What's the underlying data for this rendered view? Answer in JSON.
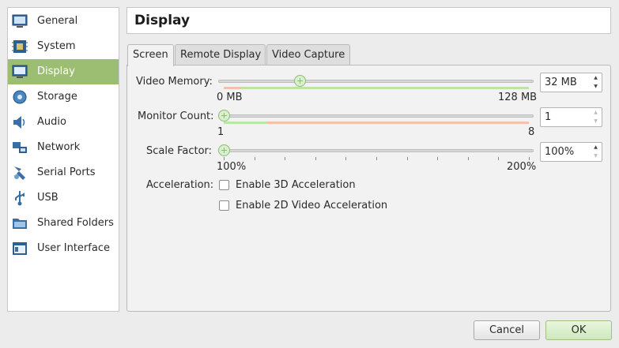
{
  "sidebar": {
    "items": [
      {
        "label": "General",
        "icon": "monitor-icon"
      },
      {
        "label": "System",
        "icon": "chip-icon"
      },
      {
        "label": "Display",
        "icon": "display-icon"
      },
      {
        "label": "Storage",
        "icon": "disk-icon"
      },
      {
        "label": "Audio",
        "icon": "speaker-icon"
      },
      {
        "label": "Network",
        "icon": "network-icon"
      },
      {
        "label": "Serial Ports",
        "icon": "serial-port-icon"
      },
      {
        "label": "USB",
        "icon": "usb-icon"
      },
      {
        "label": "Shared Folders",
        "icon": "folder-icon"
      },
      {
        "label": "User Interface",
        "icon": "window-icon"
      }
    ],
    "selected": "Display"
  },
  "header": {
    "title": "Display"
  },
  "tabs": [
    "Screen",
    "Remote Display",
    "Video Capture"
  ],
  "screen": {
    "video_memory": {
      "label": "Video Memory:",
      "min_label": "0 MB",
      "max_label": "128 MB",
      "value": "32 MB",
      "value_mb": 32,
      "range_mb": [
        0,
        128
      ]
    },
    "monitor_count": {
      "label": "Monitor Count:",
      "min_label": "1",
      "max_label": "8",
      "value": "1",
      "value_num": 1,
      "range": [
        1,
        8
      ]
    },
    "scale_factor": {
      "label": "Scale Factor:",
      "min_label": "100%",
      "max_label": "200%",
      "value": "100%",
      "value_pct": 100,
      "range_pct": [
        100,
        200
      ]
    },
    "acceleration": {
      "label": "Acceleration:",
      "enable_3d": {
        "label": "Enable 3D Acceleration",
        "checked": false
      },
      "enable_2d": {
        "label": "Enable 2D Video Acceleration",
        "checked": false
      }
    }
  },
  "buttons": {
    "cancel": "Cancel",
    "ok": "OK"
  },
  "colors": {
    "selected_bg": "#9cbe73",
    "range_ok": "#b9e6a4",
    "range_warn": "#f4c1ae"
  }
}
